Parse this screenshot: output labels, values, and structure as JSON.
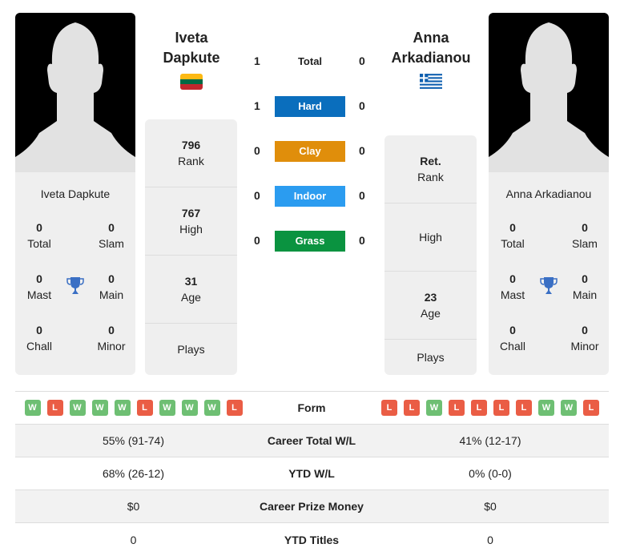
{
  "player1": {
    "header_first": "Iveta",
    "header_last": "Dapkute",
    "full_name": "Iveta Dapkute",
    "country": "Lithuania",
    "flag_colors": [
      "#fdb913",
      "#006a44",
      "#c1272d"
    ],
    "titles": {
      "total": {
        "value": "0",
        "label": "Total"
      },
      "slam": {
        "value": "0",
        "label": "Slam"
      },
      "mast": {
        "value": "0",
        "label": "Mast"
      },
      "main": {
        "value": "0",
        "label": "Main"
      },
      "chall": {
        "value": "0",
        "label": "Chall"
      },
      "minor": {
        "value": "0",
        "label": "Minor"
      }
    },
    "stats": {
      "rank": {
        "value": "796",
        "label": "Rank"
      },
      "high": {
        "value": "767",
        "label": "High"
      },
      "age": {
        "value": "31",
        "label": "Age"
      },
      "plays": {
        "value": "",
        "label": "Plays"
      }
    },
    "form": [
      "W",
      "L",
      "W",
      "W",
      "W",
      "L",
      "W",
      "W",
      "W",
      "L"
    ]
  },
  "player2": {
    "header_first": "Anna",
    "header_last": "Arkadianou",
    "full_name": "Anna Arkadianou",
    "country": "Greece",
    "flag_colors": [
      "#0d5eaf",
      "#ffffff"
    ],
    "titles": {
      "total": {
        "value": "0",
        "label": "Total"
      },
      "slam": {
        "value": "0",
        "label": "Slam"
      },
      "mast": {
        "value": "0",
        "label": "Mast"
      },
      "main": {
        "value": "0",
        "label": "Main"
      },
      "chall": {
        "value": "0",
        "label": "Chall"
      },
      "minor": {
        "value": "0",
        "label": "Minor"
      }
    },
    "stats": {
      "rank": {
        "value": "Ret.",
        "label": "Rank"
      },
      "high": {
        "value": "",
        "label": "High"
      },
      "age": {
        "value": "23",
        "label": "Age"
      },
      "plays": {
        "value": "",
        "label": "Plays"
      }
    },
    "form": [
      "L",
      "L",
      "W",
      "L",
      "L",
      "L",
      "L",
      "W",
      "W",
      "L"
    ]
  },
  "h2h": {
    "total": {
      "label": "Total",
      "p1": "1",
      "p2": "0"
    },
    "surfaces": [
      {
        "label": "Hard",
        "p1": "1",
        "p2": "0",
        "color": "#0a6ebd"
      },
      {
        "label": "Clay",
        "p1": "0",
        "p2": "0",
        "color": "#e08e0b"
      },
      {
        "label": "Indoor",
        "p1": "0",
        "p2": "0",
        "color": "#2b9cf0"
      },
      {
        "label": "Grass",
        "p1": "0",
        "p2": "0",
        "color": "#0a9340"
      }
    ]
  },
  "comparison": {
    "form_label": "Form",
    "rows": [
      {
        "label": "Career Total W/L",
        "p1": "55% (91-74)",
        "p2": "41% (12-17)"
      },
      {
        "label": "YTD W/L",
        "p1": "68% (26-12)",
        "p2": "0% (0-0)"
      },
      {
        "label": "Career Prize Money",
        "p1": "$0",
        "p2": "$0"
      },
      {
        "label": "YTD Titles",
        "p1": "0",
        "p2": "0"
      }
    ]
  },
  "colors": {
    "win": "#6ebf73",
    "loss": "#ea5d45",
    "trophy": "#3a6fc4",
    "card_bg": "#efefef"
  }
}
